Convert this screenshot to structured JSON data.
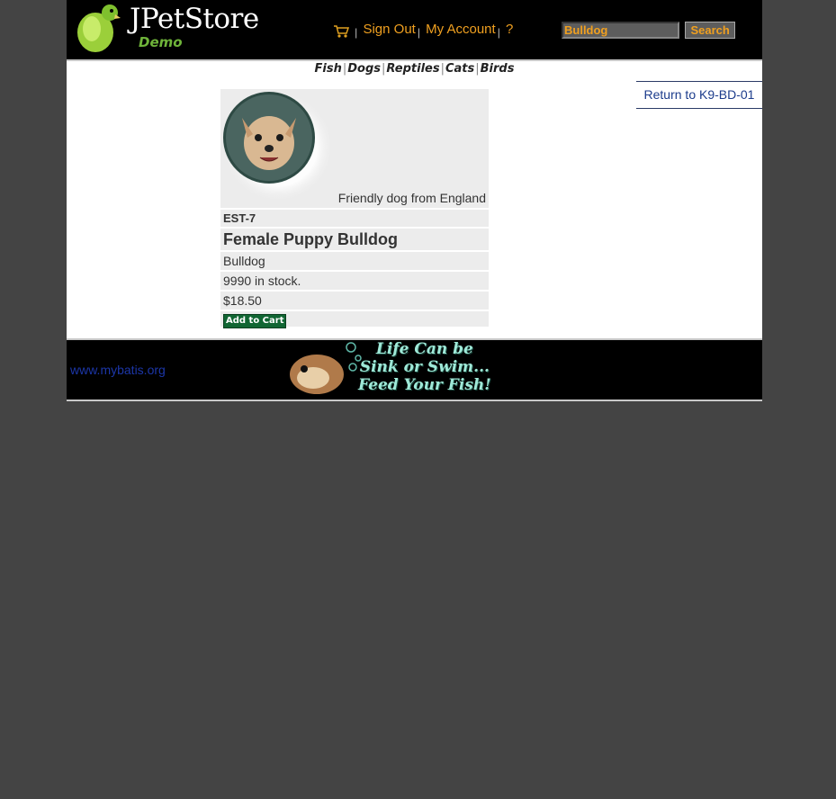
{
  "header": {
    "brand": "JPetStore",
    "brand_sub": "Demo",
    "menu": {
      "cart_icon": "cart-icon",
      "sign_out": "Sign Out",
      "my_account": "My Account",
      "help": "?"
    },
    "search": {
      "value": "Bulldog",
      "button": "Search"
    }
  },
  "quicklinks": [
    "Fish",
    "Dogs",
    "Reptiles",
    "Cats",
    "Birds"
  ],
  "back_link": "Return to K9-BD-01",
  "item": {
    "image_caption": "Friendly dog from England",
    "id": "EST-7",
    "name": "Female Puppy Bulldog",
    "attribute": "Bulldog",
    "stock": "9990 in stock.",
    "price": "$18.50",
    "add_to_cart": "Add to Cart"
  },
  "footer": {
    "link": "www.mybatis.org",
    "banner_text": [
      "Life Can be",
      "Sink or Swim...",
      "Feed Your Fish!"
    ]
  },
  "colors": {
    "accent": "#f0a020",
    "link": "#1c3c8c",
    "background": "#444444"
  }
}
